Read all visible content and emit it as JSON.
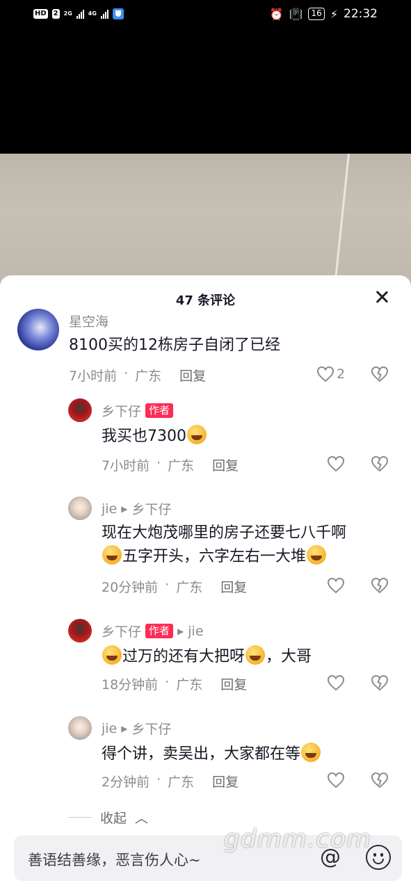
{
  "status_bar": {
    "left": {
      "hd_label": "HD",
      "sim": "2",
      "net1": "2G",
      "net2": "4G"
    },
    "battery": "16",
    "time": "22:32"
  },
  "comments_sheet": {
    "title": "47 条评论",
    "comments": [
      {
        "user": "星空海",
        "text": "8100买的12栋房子自闭了已经",
        "time": "7小时前",
        "location": "广东",
        "reply_label": "回复",
        "likes": "2"
      },
      {
        "user": "乡下仔",
        "badge": "作者",
        "text_before": "我买也7300",
        "time": "7小时前",
        "location": "广东",
        "reply_label": "回复"
      },
      {
        "user": "jie",
        "reply_to": "乡下仔",
        "text_line1": "现在大炮茂哪里的房子还要七八千啊",
        "text_line2a": "五字开头，六字左右一大堆",
        "time": "20分钟前",
        "location": "广东",
        "reply_label": "回复"
      },
      {
        "user": "乡下仔",
        "badge": "作者",
        "reply_to": "jie",
        "text_a": "过万的还有大把呀",
        "text_b": "，大哥",
        "time": "18分钟前",
        "location": "广东",
        "reply_label": "回复"
      },
      {
        "user": "jie",
        "reply_to": "乡下仔",
        "text_a": "得个讲，卖吴出，大家都在等",
        "time": "2分钟前",
        "location": "广东",
        "reply_label": "回复"
      }
    ],
    "collapse_label": "收起"
  },
  "input_bar": {
    "placeholder": "善语结善缘，恶言伤人心~",
    "at_symbol": "@"
  },
  "watermark": "gdmm.com"
}
